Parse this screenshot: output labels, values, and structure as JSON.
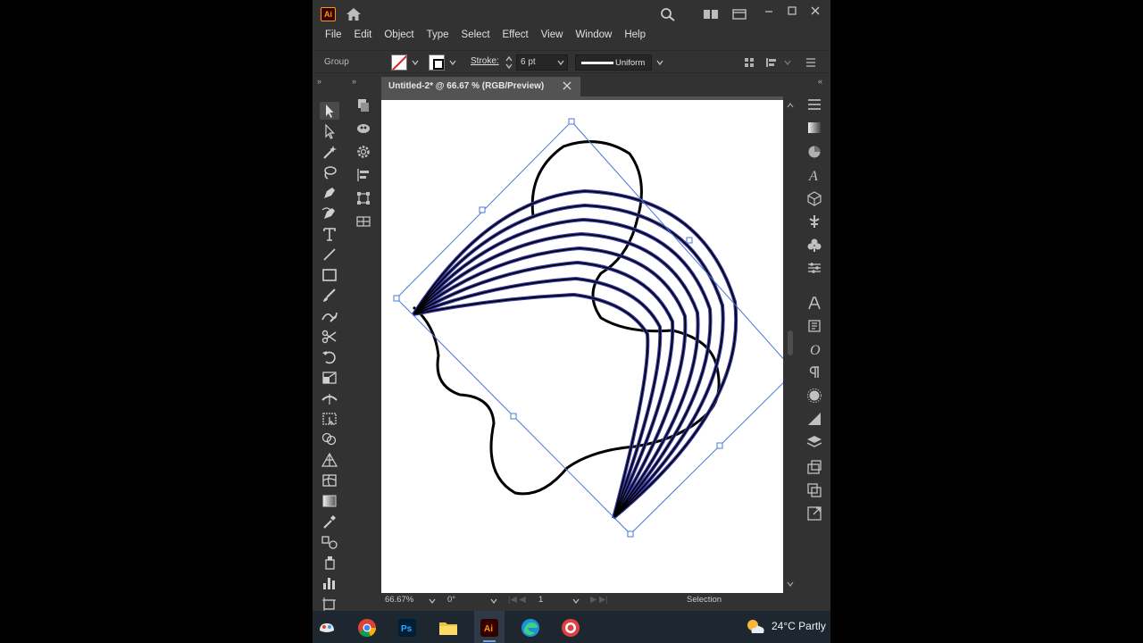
{
  "app": {
    "logo_text": "Ai"
  },
  "menu": [
    "File",
    "Edit",
    "Object",
    "Type",
    "Select",
    "Effect",
    "View",
    "Window",
    "Help"
  ],
  "control_bar": {
    "selection_label": "Group",
    "stroke_label": "Stroke:",
    "stroke_weight": "6 pt",
    "profile_label": "Uniform"
  },
  "document": {
    "tab_title": "Untitled-2* @ 66.67 % (RGB/Preview)"
  },
  "status_bar": {
    "zoom": "66.67%",
    "rotation": "0°",
    "artboard_number": "1",
    "tool_status": "Selection"
  },
  "taskbar": {
    "weather": "24°C  Partly"
  },
  "colors": {
    "app_bg": "#323232",
    "canvas_bg": "#535353",
    "selection_blue": "#4a78d8",
    "stroke_highlight": "#3a3aa8"
  },
  "tools_left": [
    "selection-tool",
    "direct-selection-tool",
    "magic-wand-tool",
    "lasso-tool",
    "pen-tool",
    "curvature-tool",
    "type-tool",
    "line-tool",
    "rectangle-tool",
    "paintbrush-tool",
    "shaper-tool",
    "scissors-tool",
    "rotate-tool",
    "scale-tool",
    "width-tool",
    "free-transform-tool",
    "shape-builder-tool",
    "perspective-grid-tool",
    "mesh-tool",
    "gradient-tool",
    "eyedropper-tool",
    "blend-tool",
    "symbol-sprayer-tool",
    "column-graph-tool",
    "artboard-tool"
  ]
}
